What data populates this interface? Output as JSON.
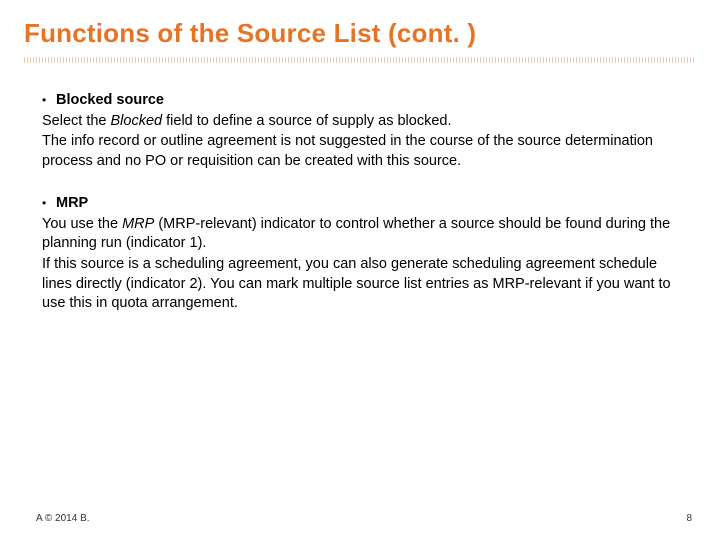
{
  "slide": {
    "title": "Functions of the Source List (cont. )",
    "sections": [
      {
        "bullet_label": "Blocked source",
        "paragraphs": [
          {
            "pre": "Select the ",
            "em": "Blocked",
            "post": " field to define a source of supply as blocked."
          },
          {
            "pre": "The info record or outline agreement is not suggested in the course of the source determination process and no PO or requisition can be created with this source.",
            "em": "",
            "post": ""
          }
        ]
      },
      {
        "bullet_label": "MRP",
        "paragraphs": [
          {
            "pre": "You use the ",
            "em": "MRP",
            "post": " (MRP-relevant) indicator to control whether a source should be found during the planning run (indicator 1)."
          },
          {
            "pre": "If this source is a scheduling agreement, you can also generate scheduling agreement schedule lines directly (indicator 2). You can mark multiple source list entries as MRP-relevant if you want to use this in quota arrangement.",
            "em": "",
            "post": ""
          }
        ]
      }
    ],
    "footer_left": "A © 2014 B.",
    "footer_right": "8"
  }
}
